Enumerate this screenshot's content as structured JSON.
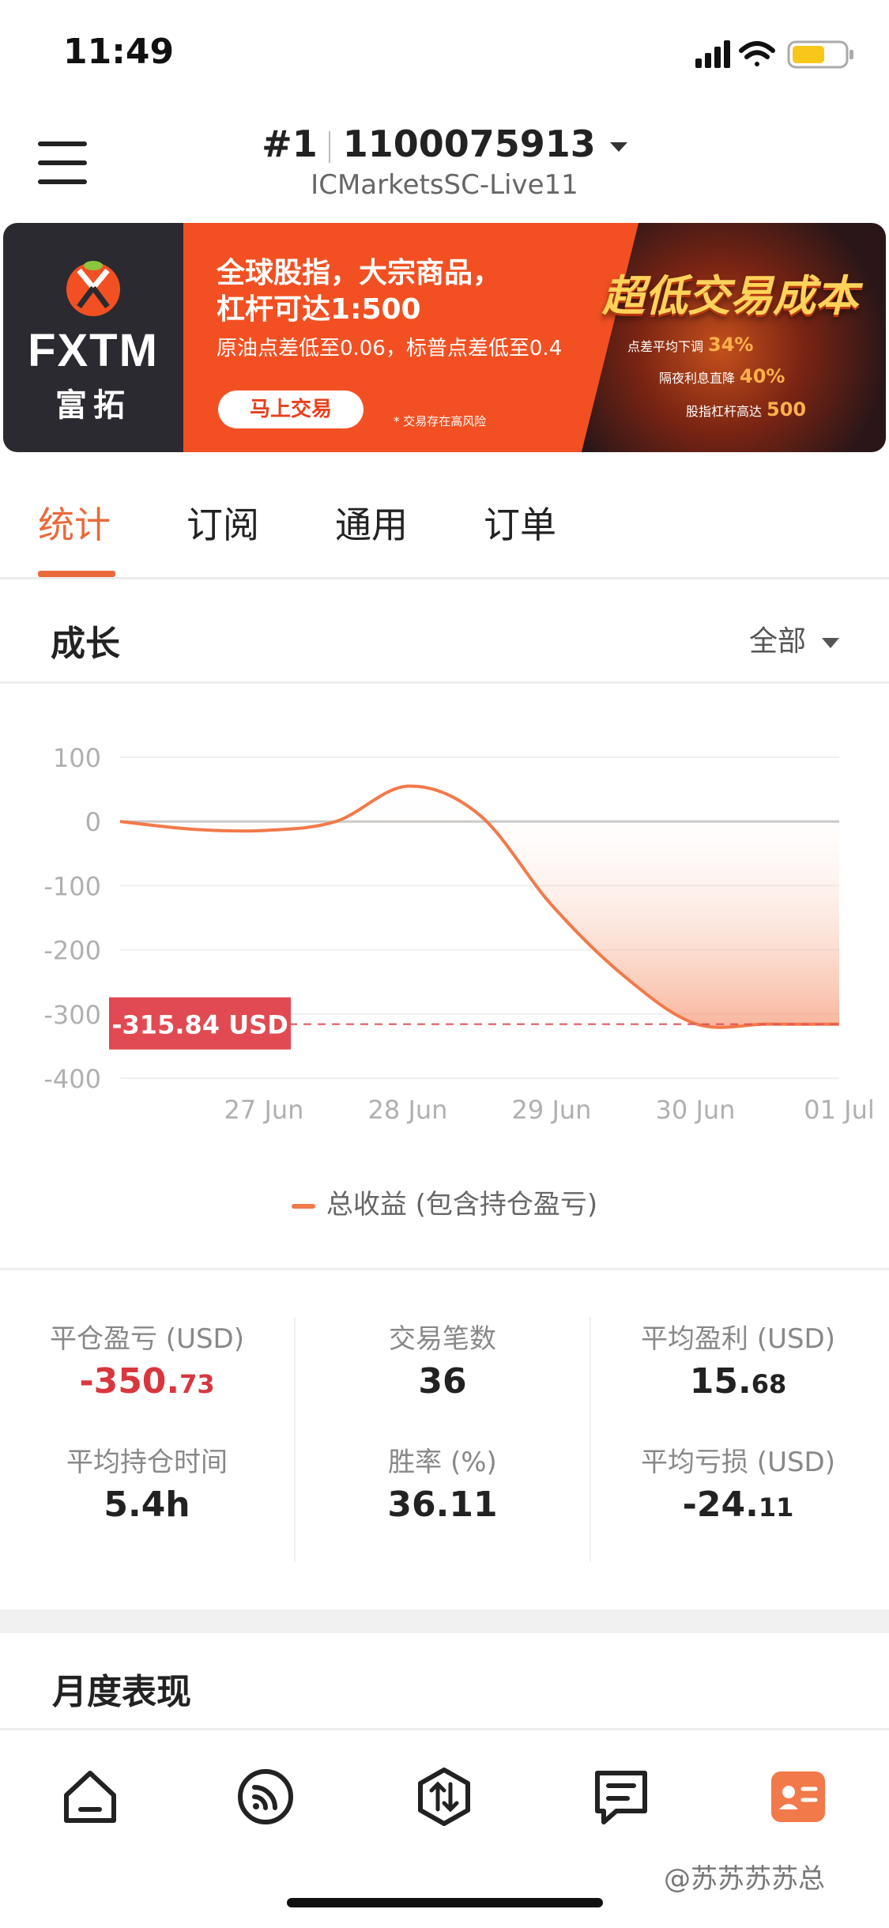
{
  "status_bar": {
    "time": "11:49"
  },
  "header": {
    "account_index": "#1",
    "account_number": "1100075913",
    "server": "ICMarketsSC-Live11"
  },
  "banner": {
    "brand_name": "FXTM",
    "brand_cn": "富拓",
    "line1": "全球股指，大宗商品，",
    "line2": "杠杆可达1:500",
    "line3": "原油点差低至0.06，标普点差低至0.4",
    "cta": "马上交易",
    "risk_note": "* 交易存在高风险",
    "headline": "超低交易成本",
    "sub1_label": "点差平均下调",
    "sub1_value": "34%",
    "sub2_label": "隔夜利息直降",
    "sub2_value": "40%",
    "sub3_label": "股指杠杆高达",
    "sub3_value": "500",
    "colors": {
      "left": "#2a2a30",
      "mid": "#f25022",
      "accent": "#ffd35a"
    }
  },
  "tabs": [
    {
      "label": "统计",
      "active": true
    },
    {
      "label": "订阅",
      "active": false
    },
    {
      "label": "通用",
      "active": false
    },
    {
      "label": "订单",
      "active": false
    }
  ],
  "growth": {
    "title": "成长",
    "filter": "全部"
  },
  "chart_data": {
    "type": "area",
    "y_ticks": [
      "100",
      "0",
      "-100",
      "-200",
      "-300",
      "-400"
    ],
    "ylim": [
      -400,
      100
    ],
    "x_ticks": [
      "27 Jun",
      "28 Jun",
      "29 Jun",
      "30 Jun",
      "01 Jul"
    ],
    "x": [
      0,
      0.5,
      1,
      1.5,
      2,
      2.5,
      3,
      3.5,
      4,
      4.5,
      5
    ],
    "y": [
      0,
      -12,
      -14,
      0,
      55,
      10,
      -130,
      -240,
      -315,
      -315.84,
      -315.84
    ],
    "current_value_label": "-315.84 USD",
    "current_value": -315.84,
    "series": [
      {
        "name": "总收益 (包含持仓盈亏)",
        "color": "#f2794a"
      }
    ],
    "legend": "bottom-center",
    "grid": true
  },
  "stats": [
    {
      "label": "平仓盈亏 (USD)",
      "int": "-350.",
      "dec": "73",
      "negative": true
    },
    {
      "label": "交易笔数",
      "int": "36",
      "dec": "",
      "negative": false
    },
    {
      "label": "平均盈利 (USD)",
      "int": "15.",
      "dec": "68",
      "negative": false
    },
    {
      "label": "平均持仓时间",
      "int": "5.4h",
      "dec": "",
      "negative": false
    },
    {
      "label": "胜率 (%)",
      "int": "36.11",
      "dec": "",
      "negative": false
    },
    {
      "label": "平均亏损 (USD)",
      "int": "-24.",
      "dec": "11",
      "negative": false
    }
  ],
  "monthly": {
    "title": "月度表现"
  },
  "bottom_nav": [
    {
      "icon": "home-icon"
    },
    {
      "icon": "signal-icon"
    },
    {
      "icon": "trade-icon"
    },
    {
      "icon": "news-icon"
    },
    {
      "icon": "profile-card-icon",
      "active": true
    }
  ],
  "watermark": "@苏苏苏苏总"
}
